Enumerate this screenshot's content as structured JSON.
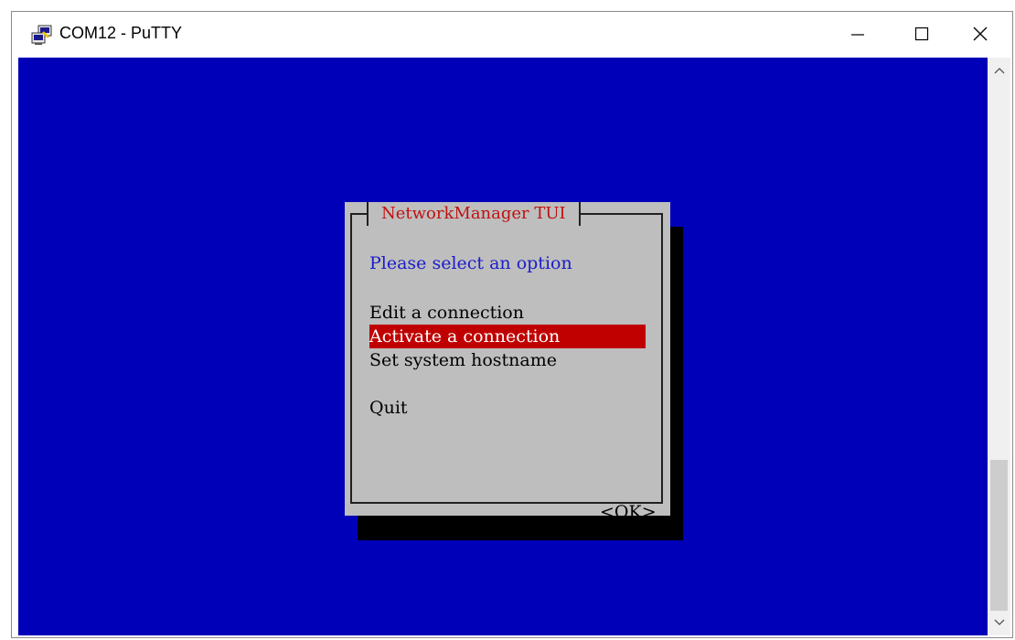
{
  "window": {
    "title": "COM12 - PuTTY",
    "minimize_label": "—",
    "maximize_label": "☐",
    "close_label": "✕"
  },
  "dialog": {
    "title": "NetworkManager TUI",
    "prompt": "Please select an option",
    "items": [
      {
        "label": "Edit a connection",
        "selected": false
      },
      {
        "label": "Activate a connection",
        "selected": true
      },
      {
        "label": "Set system hostname",
        "selected": false
      },
      {
        "label": "Quit",
        "selected": false
      }
    ],
    "ok_label": "<OK>"
  },
  "colors": {
    "terminal_bg": "#0000b8",
    "dialog_bg": "#bebebe",
    "title_text": "#c01010",
    "prompt_text": "#1c1cc8",
    "selected_bg": "#c00000"
  },
  "icons": {
    "app": "putty-icon",
    "scroll_up": "chevron-up-icon",
    "scroll_down": "chevron-down-icon"
  }
}
